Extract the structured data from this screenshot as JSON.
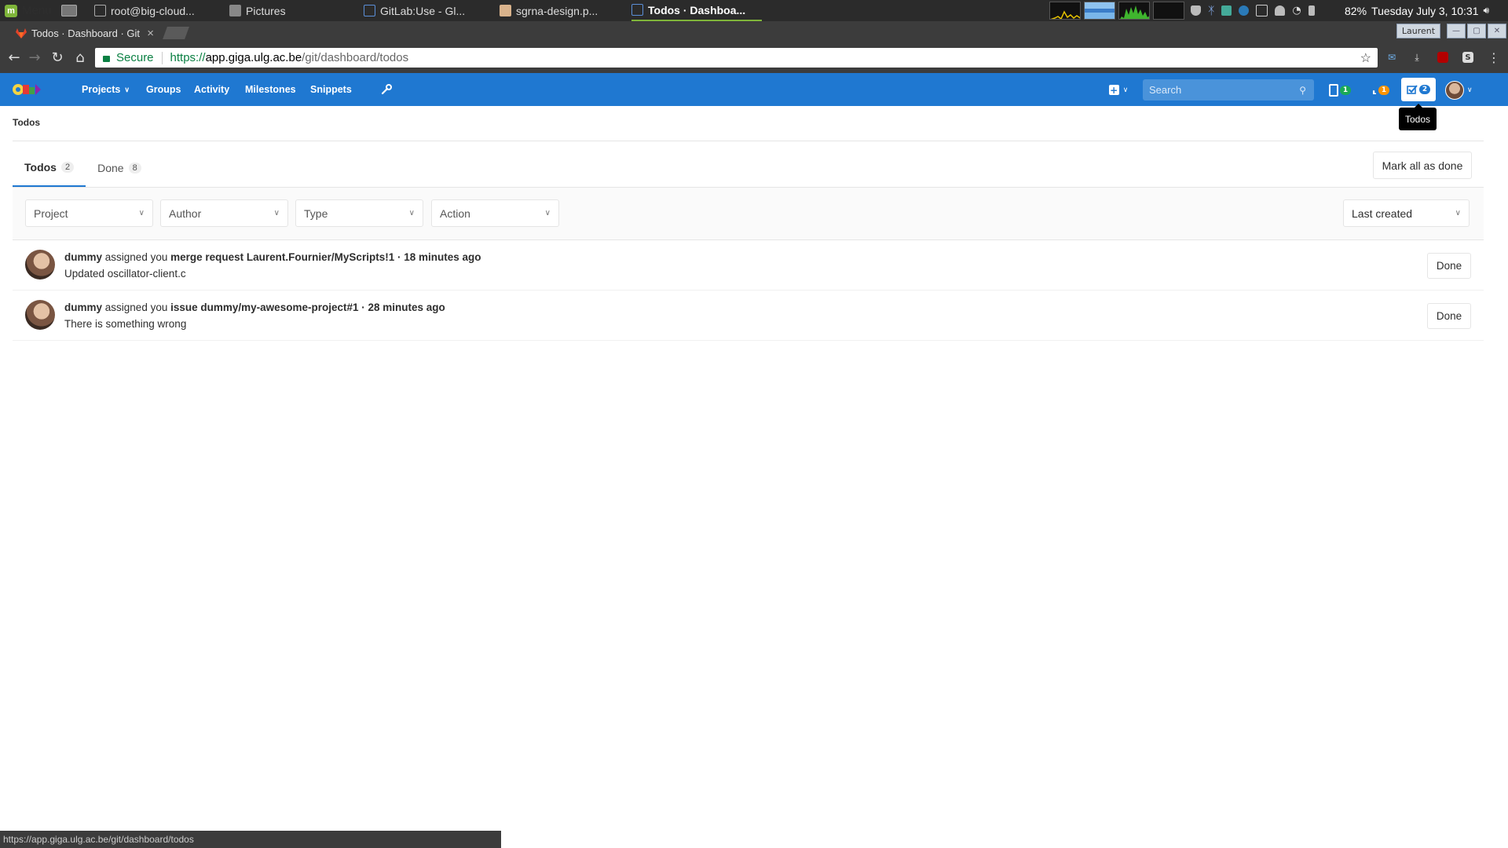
{
  "os": {
    "menu_label": "Menu",
    "tasks": [
      {
        "label": "root@big-cloud..."
      },
      {
        "label": "Pictures"
      },
      {
        "label": "GitLab:Use - Gl..."
      },
      {
        "label": "sgrna-design.p..."
      },
      {
        "label": "Todos · Dashboa..."
      }
    ],
    "battery": "82%",
    "datetime": "Tuesday July  3, 10:31"
  },
  "browser": {
    "tab_title": "Todos · Dashboard · Git",
    "wm_user": "Laurent",
    "secure_label": "Secure",
    "url_scheme": "https://",
    "url_host": "app.giga.ulg.ac.be",
    "url_path": "/git/dashboard/todos",
    "status_url": "https://app.giga.ulg.ac.be/git/dashboard/todos"
  },
  "gitlab": {
    "nav": {
      "projects": "Projects",
      "groups": "Groups",
      "activity": "Activity",
      "milestones": "Milestones",
      "snippets": "Snippets"
    },
    "search_placeholder": "Search",
    "issues_count": "1",
    "mr_count": "1",
    "todos_count": "2",
    "tooltip": "Todos",
    "accent": "#1f78d1"
  },
  "page": {
    "breadcrumb": "Todos",
    "tabs": [
      {
        "label": "Todos",
        "count": "2"
      },
      {
        "label": "Done",
        "count": "8"
      }
    ],
    "mark_all_label": "Mark all as done",
    "filters": {
      "project": "Project",
      "author": "Author",
      "type": "Type",
      "action": "Action",
      "sort": "Last created"
    },
    "todos": [
      {
        "author": "dummy",
        "action": "assigned you",
        "target_type": "merge request",
        "target": "Laurent.Fournier/MyScripts!1",
        "sep": "·",
        "time": "18 minutes ago",
        "body": "Updated oscillator-client.c",
        "done_label": "Done"
      },
      {
        "author": "dummy",
        "action": "assigned you",
        "target_type": "issue",
        "target": "dummy/my-awesome-project#1",
        "sep": "·",
        "time": "28 minutes ago",
        "body": "There is something wrong",
        "done_label": "Done"
      }
    ]
  }
}
